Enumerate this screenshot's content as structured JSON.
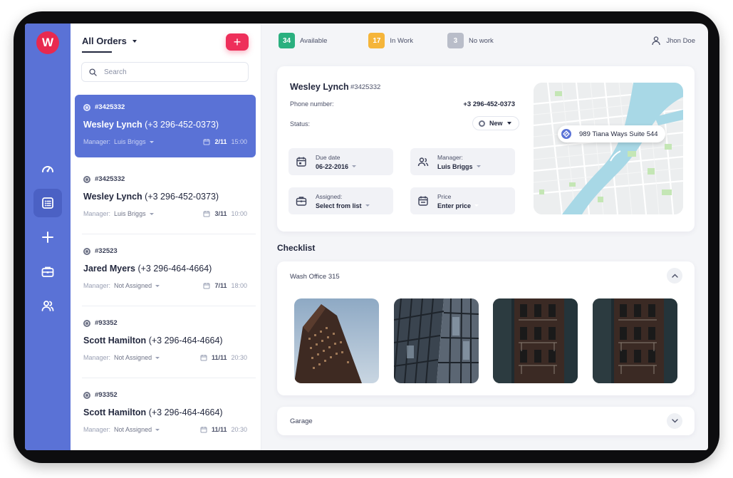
{
  "brand": {
    "logo_letter": "W",
    "accent": "#5a72d6",
    "brand_red": "#e8294f"
  },
  "sidebar": {
    "items": [
      {
        "name": "dashboard",
        "icon": "speedometer-icon"
      },
      {
        "name": "orders",
        "icon": "list-icon",
        "active": true
      },
      {
        "name": "add",
        "icon": "plus-icon"
      },
      {
        "name": "jobs",
        "icon": "briefcase-icon"
      },
      {
        "name": "team",
        "icon": "users-icon"
      }
    ]
  },
  "orders_panel": {
    "title": "All Orders",
    "add_label": "+",
    "search_placeholder": "Search",
    "items": [
      {
        "id": "#3425332",
        "name": "Wesley Lynch",
        "phone": "(+3 296-452-0373)",
        "manager_label": "Manager:",
        "manager": "Luis Briggs",
        "date": "2/11",
        "time": "15:00",
        "active": true
      },
      {
        "id": "#3425332",
        "name": "Wesley Lynch",
        "phone": "(+3 296-452-0373)",
        "manager_label": "Manager:",
        "manager": "Luis Briggs",
        "date": "3/11",
        "time": "10:00"
      },
      {
        "id": "#32523",
        "name": "Jared Myers",
        "phone": "(+3 296-464-4664)",
        "manager_label": "Manager:",
        "manager": "Not Assigned",
        "date": "7/11",
        "time": "18:00"
      },
      {
        "id": "#93352",
        "name": "Scott Hamilton",
        "phone": "(+3 296-464-4664)",
        "manager_label": "Manager:",
        "manager": "Not Assigned",
        "date": "11/11",
        "time": "20:30"
      },
      {
        "id": "#93352",
        "name": "Scott Hamilton",
        "phone": "(+3 296-464-4664)",
        "manager_label": "Manager:",
        "manager": "Not Assigned",
        "date": "11/11",
        "time": "20:30"
      }
    ]
  },
  "topbar": {
    "stats": [
      {
        "count": "34",
        "label": "Available",
        "color": "#2bb07f"
      },
      {
        "count": "17",
        "label": "In Work",
        "color": "#f5b53a"
      },
      {
        "count": "3",
        "label": "No work",
        "color": "#b9bdc9"
      }
    ],
    "user": "Jhon Doe"
  },
  "detail": {
    "name": "Wesley Lynch",
    "id": "#3425332",
    "phone_label": "Phone number:",
    "phone": "+3 296-452-0373",
    "status_label": "Status:",
    "status": "New",
    "fields": {
      "due": {
        "label": "Due date",
        "value": "06-22-2016"
      },
      "manager": {
        "label": "Manager:",
        "value": "Luis Briggs"
      },
      "assigned": {
        "label": "Assigned:",
        "value": "Select from list"
      },
      "price": {
        "label": "Price",
        "value": "Enter price"
      }
    },
    "map_address": "989 Tiana Ways Suite 544"
  },
  "checklist": {
    "title": "Checklist",
    "groups": [
      {
        "title": "Wash Office 315",
        "expanded": true
      },
      {
        "title": "Garage",
        "expanded": false
      }
    ]
  }
}
